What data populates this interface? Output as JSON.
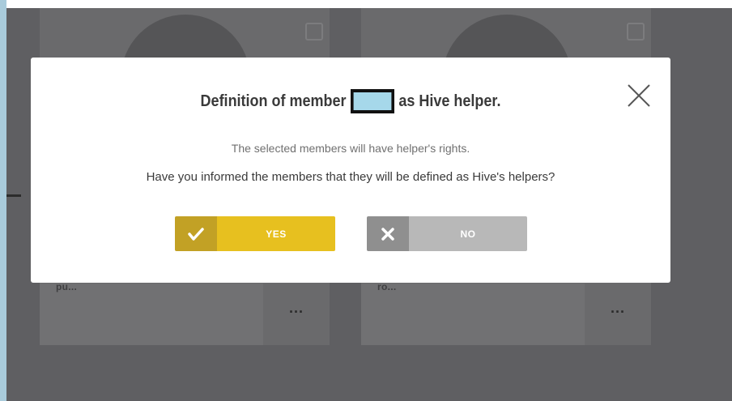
{
  "background": {
    "cards": [
      {
        "name": "pu...",
        "menu": "..."
      },
      {
        "name": "ro...",
        "menu": "..."
      }
    ]
  },
  "modal": {
    "title_prefix": "Definition of member",
    "title_suffix": "as Hive helper.",
    "close_icon": "close-x",
    "line1": "The selected members will have helper's rights.",
    "line2": "Have you informed the members that they will be defined as Hive's helpers?",
    "yes_label": "YES",
    "no_label": "NO"
  },
  "colors": {
    "yes_accent": "#e7c01f",
    "yes_icon_bg": "#c2a125",
    "no_accent": "#b8b8b8",
    "no_icon_bg": "#8f8f8f",
    "overlay": "#5f5f62",
    "redaction": "#a6d8ea"
  }
}
